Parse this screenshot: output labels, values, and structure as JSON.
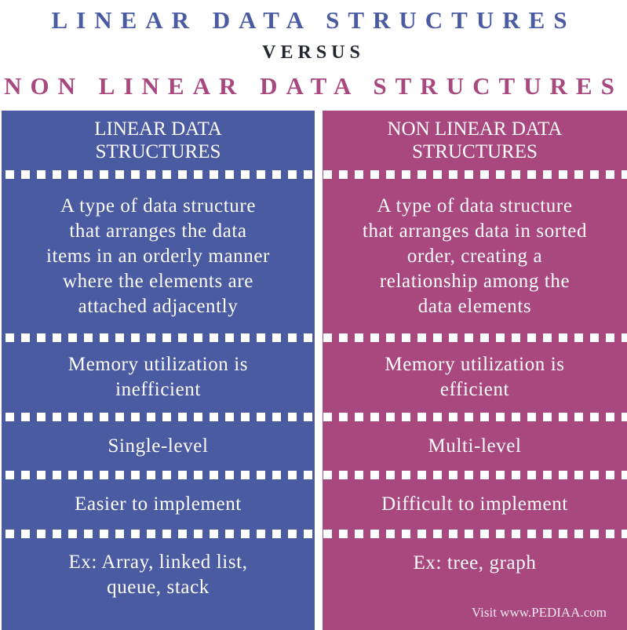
{
  "title": {
    "line1": "LINEAR DATA STRUCTURES",
    "versus": "VERSUS",
    "line2": "NON LINEAR DATA STRUCTURES"
  },
  "colors": {
    "linear": "#4a5ba1",
    "non_linear": "#a8487f",
    "versus": "#222631"
  },
  "columns": {
    "left": {
      "header": [
        "LINEAR DATA",
        "STRUCTURES"
      ],
      "rows": [
        [
          "A type of data structure",
          "that arranges the data",
          "items in an orderly manner",
          "where the elements are",
          "attached adjacently"
        ],
        [
          "Memory utilization is",
          "inefficient"
        ],
        [
          "Single-level"
        ],
        [
          "Easier to implement"
        ],
        [
          "Ex: Array, linked list,",
          "queue, stack"
        ]
      ]
    },
    "right": {
      "header": [
        "NON LINEAR DATA",
        "STRUCTURES"
      ],
      "rows": [
        [
          "A type of data structure",
          "that arranges data in sorted",
          "order, creating a",
          "relationship among the",
          "data elements"
        ],
        [
          "Memory utilization is",
          "efficient"
        ],
        [
          "Multi-level"
        ],
        [
          "Difficult to implement"
        ],
        [
          "Ex: tree, graph"
        ]
      ]
    }
  },
  "footer": {
    "credit": "Visit www.PEDIAA.com"
  }
}
